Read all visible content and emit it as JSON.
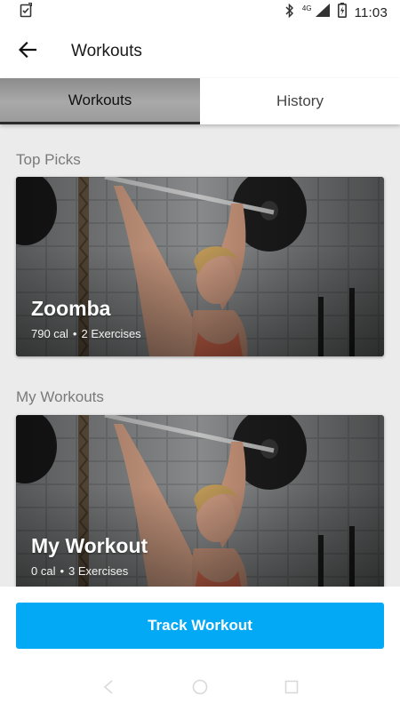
{
  "status_bar": {
    "network_label": "4G",
    "time": "11:03",
    "icons": [
      "clipboard-check-icon",
      "bluetooth-icon",
      "signal-icon",
      "battery-icon"
    ]
  },
  "app_bar": {
    "title": "Workouts",
    "back_icon": "arrow-back-icon"
  },
  "tabs": [
    {
      "label": "Workouts",
      "active": true
    },
    {
      "label": "History",
      "active": false
    }
  ],
  "sections": {
    "top_picks": {
      "title": "Top Picks",
      "card": {
        "name": "Zoomba",
        "calories": "790 cal",
        "separator": "•",
        "exercises": "2 Exercises"
      }
    },
    "my_workouts": {
      "title": "My Workouts",
      "card": {
        "name": "My Workout",
        "calories": "0 cal",
        "separator": "•",
        "exercises": "3 Exercises"
      }
    }
  },
  "action": {
    "track_label": "Track Workout",
    "color": "#03a9f4"
  },
  "nav": {
    "icons": [
      "back-nav-icon",
      "home-nav-icon",
      "recents-nav-icon"
    ]
  }
}
